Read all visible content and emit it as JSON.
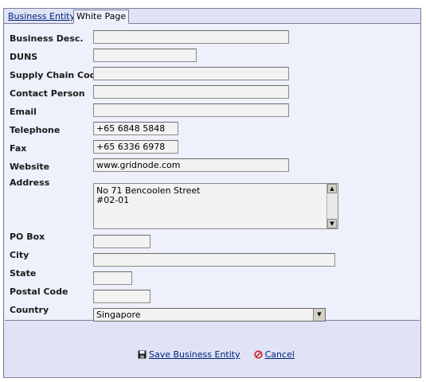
{
  "tabs": [
    {
      "label": "Business Entity",
      "active": false
    },
    {
      "label": "White Page",
      "active": true
    }
  ],
  "form": {
    "business_desc": {
      "label": "Business Desc.",
      "value": ""
    },
    "duns": {
      "label": "DUNS",
      "value": ""
    },
    "supply_chain_code": {
      "label": "Supply Chain Code",
      "value": ""
    },
    "contact_person": {
      "label": "Contact Person",
      "value": ""
    },
    "email": {
      "label": "Email",
      "value": ""
    },
    "telephone": {
      "label": "Telephone",
      "value": "+65 6848 5848"
    },
    "fax": {
      "label": "Fax",
      "value": "+65 6336 6978"
    },
    "website": {
      "label": "Website",
      "value": "www.gridnode.com"
    },
    "address": {
      "label": "Address",
      "value": "No 71 Bencoolen Street\n#02-01"
    },
    "po_box": {
      "label": "PO Box",
      "value": ""
    },
    "city": {
      "label": "City",
      "value": ""
    },
    "state": {
      "label": "State",
      "value": ""
    },
    "postal_code": {
      "label": "Postal Code",
      "value": ""
    },
    "country": {
      "label": "Country",
      "value": "Singapore"
    }
  },
  "actions": {
    "save_label": "Save Business Entity",
    "cancel_label": "Cancel"
  },
  "icons": {
    "save": "floppy-disk-icon",
    "cancel": "cancel-circle-icon",
    "dropdown": "triangle-down-icon",
    "scroll_up": "triangle-up-icon",
    "scroll_down": "triangle-down-icon"
  },
  "colors": {
    "panel_bg": "#dfe3f5",
    "form_bg": "#eef0fb",
    "link": "#00207a",
    "cancel_icon": "#d02020"
  }
}
